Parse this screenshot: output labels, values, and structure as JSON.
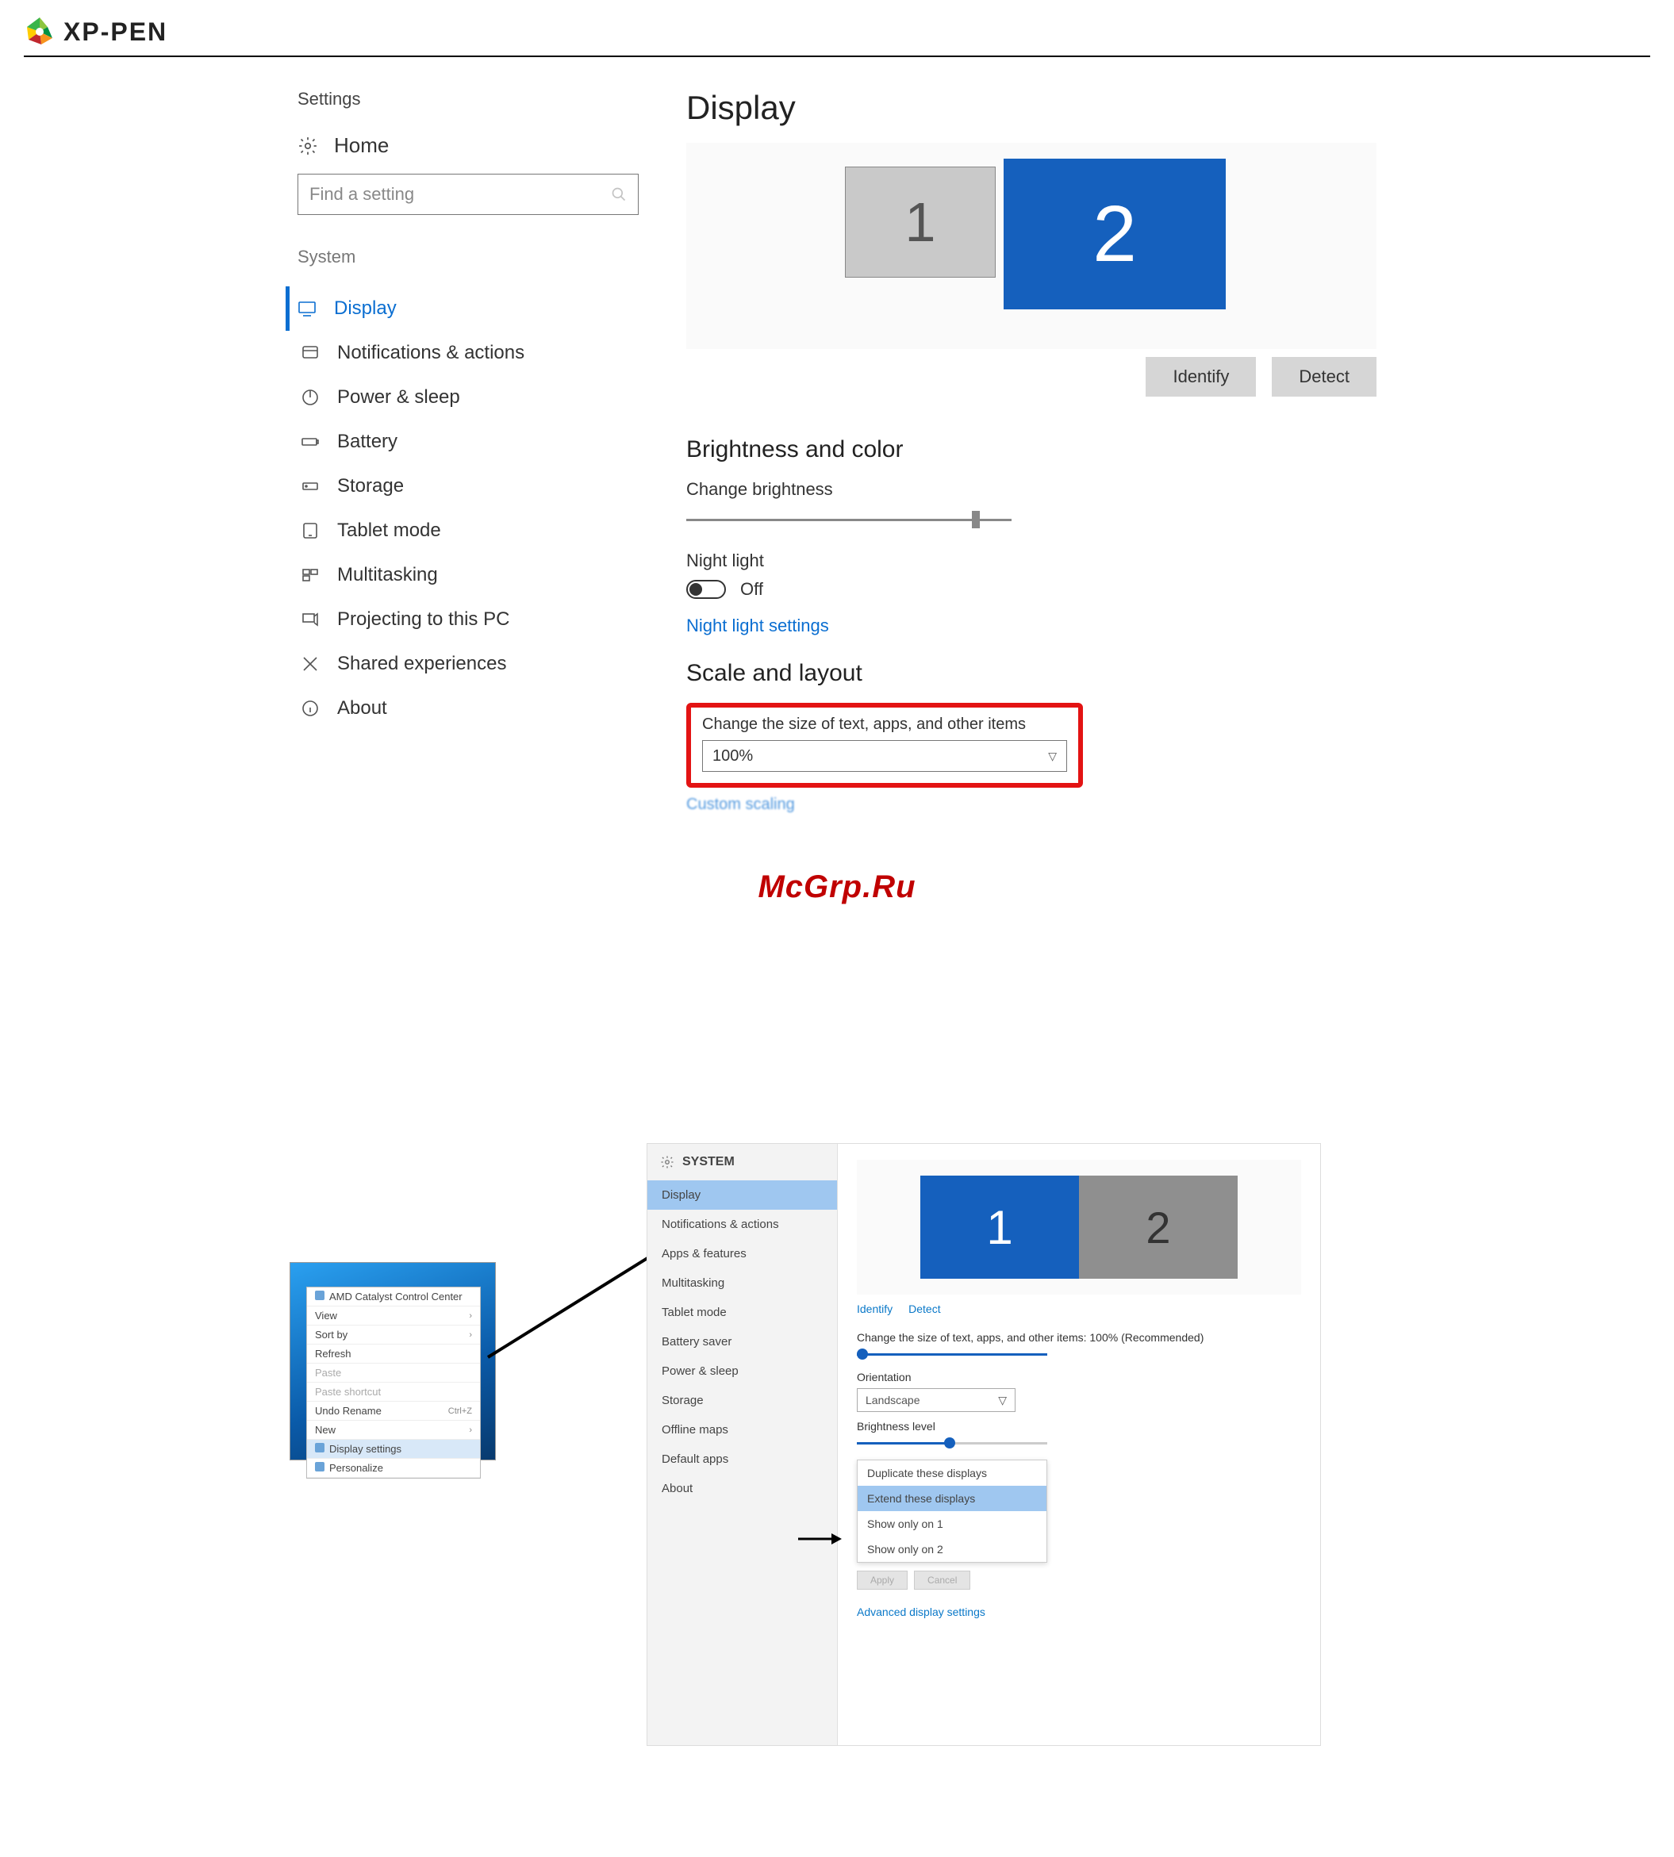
{
  "brand": "XP-PEN",
  "watermark": "McGrp.Ru",
  "screenshot1": {
    "settings_label": "Settings",
    "home": "Home",
    "search_placeholder": "Find a setting",
    "system_label": "System",
    "nav": [
      {
        "label": "Display",
        "active": true
      },
      {
        "label": "Notifications & actions"
      },
      {
        "label": "Power & sleep"
      },
      {
        "label": "Battery"
      },
      {
        "label": "Storage"
      },
      {
        "label": "Tablet mode"
      },
      {
        "label": "Multitasking"
      },
      {
        "label": "Projecting to this PC"
      },
      {
        "label": "Shared experiences"
      },
      {
        "label": "About"
      }
    ],
    "heading": "Display",
    "monitor1": "1",
    "monitor2": "2",
    "identify": "Identify",
    "detect": "Detect",
    "brightness_heading": "Brightness and color",
    "change_brightness": "Change brightness",
    "night_light_label": "Night light",
    "night_light_state": "Off",
    "night_light_link": "Night light settings",
    "scale_heading": "Scale and layout",
    "scale_label": "Change the size of text, apps, and other items",
    "scale_value": "100%",
    "custom_scaling": "Custom scaling"
  },
  "context_menu": {
    "items": [
      "AMD Catalyst Control Center",
      "View",
      "Sort by",
      "Refresh",
      "Paste",
      "Paste shortcut",
      "Undo Rename",
      "New",
      "Display settings",
      "Personalize"
    ],
    "undo_hint": "Ctrl+Z"
  },
  "screenshot2": {
    "header": "SYSTEM",
    "nav": [
      {
        "label": "Display",
        "active": true
      },
      {
        "label": "Notifications & actions"
      },
      {
        "label": "Apps & features"
      },
      {
        "label": "Multitasking"
      },
      {
        "label": "Tablet mode"
      },
      {
        "label": "Battery saver"
      },
      {
        "label": "Power & sleep"
      },
      {
        "label": "Storage"
      },
      {
        "label": "Offline maps"
      },
      {
        "label": "Default apps"
      },
      {
        "label": "About"
      }
    ],
    "monitor1": "1",
    "monitor2": "2",
    "identify": "Identify",
    "detect": "Detect",
    "scale_label": "Change the size of text, apps, and other items: 100% (Recommended)",
    "orientation_label": "Orientation",
    "orientation_value": "Landscape",
    "brightness_label": "Brightness level",
    "dropdown": [
      "Duplicate these displays",
      "Extend these displays",
      "Show only on 1",
      "Show only on 2"
    ],
    "apply": "Apply",
    "cancel": "Cancel",
    "advanced": "Advanced display settings"
  }
}
